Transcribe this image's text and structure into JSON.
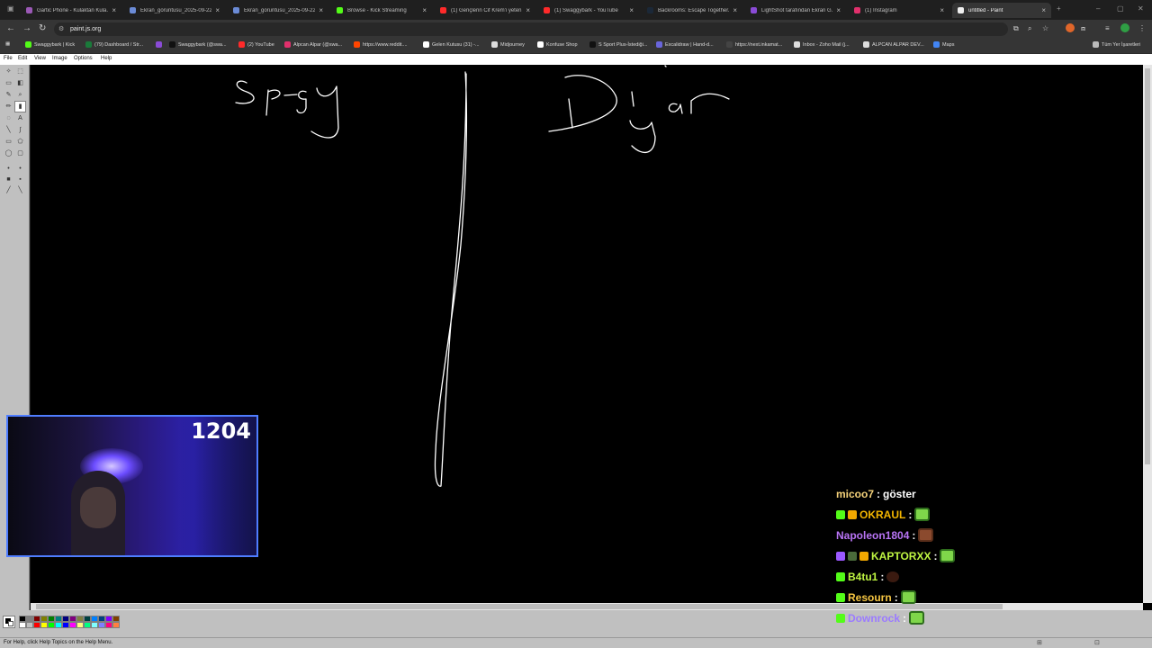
{
  "browser": {
    "tabs": [
      {
        "title": "Gartic Phone - Kulaktan Kula...",
        "color": "#9b59b6",
        "active": false
      },
      {
        "title": "Ekran_goruntusu_2025-09-22...",
        "color": "#6b8bd6",
        "active": false
      },
      {
        "title": "Ekran_goruntusu_2025-09-22...",
        "color": "#6b8bd6",
        "active": false
      },
      {
        "title": "Browse - Kick Streaming",
        "color": "#53fc18",
        "active": false
      },
      {
        "title": "(1) Gençlerin Cif Krem'i yeten...",
        "color": "#ff2a2a",
        "active": false
      },
      {
        "title": "(1) Swaggybark - YouTube",
        "color": "#ff2a2a",
        "active": false
      },
      {
        "title": "Backrooms: Escape Together...",
        "color": "#1b2838",
        "active": false
      },
      {
        "title": "LightShot tarafından Ekran G...",
        "color": "#8a4bd6",
        "active": false
      },
      {
        "title": "(1) Instagram",
        "color": "#e1306c",
        "active": false
      },
      {
        "title": "untitled - Paint",
        "color": "#f0f0f0",
        "active": true
      }
    ],
    "new_tab": "+",
    "url": "paint.js.org",
    "bookmarks": [
      {
        "label": "Swaggybark | Kick",
        "color": "#53fc18"
      },
      {
        "label": "(79) Dashboard / Str...",
        "color": "#1a7a3a"
      },
      {
        "label": "",
        "color": "#8a4bd6"
      },
      {
        "label": "Swaggybark (@swa...",
        "color": "#111111"
      },
      {
        "label": "(2) YouTube",
        "color": "#ff2a2a"
      },
      {
        "label": "Alpcan Alpar (@swa...",
        "color": "#e1306c"
      },
      {
        "label": "https://www.reddit....",
        "color": "#ff4500"
      },
      {
        "label": "Gelen Kutusu (31) -...",
        "color": "#ffffff"
      },
      {
        "label": "Midjourney",
        "color": "#dddddd"
      },
      {
        "label": "Konfuse Shop",
        "color": "#ffffff"
      },
      {
        "label": "S Sport Plus-İstediği...",
        "color": "#111111"
      },
      {
        "label": "Excalidraw | Hand-d...",
        "color": "#6965db"
      },
      {
        "label": "https://next.inkamat...",
        "color": "#444444"
      },
      {
        "label": "Inbox - Zoho Mail (j...",
        "color": "#dddddd"
      },
      {
        "label": "ALPCAN ALPAR DEV...",
        "color": "#dddddd"
      },
      {
        "label": "Maps",
        "color": "#4285f4"
      }
    ],
    "all_bookmarks": "Tüm Yer İşaretleri"
  },
  "paint": {
    "menu": [
      "File",
      "Edit",
      "View",
      "Image",
      "Options",
      "Help"
    ],
    "status": "For Help, click Help Topics on the Help Menu.",
    "palette": [
      "#000000",
      "#808080",
      "#800000",
      "#808000",
      "#008000",
      "#008080",
      "#000080",
      "#800080",
      "#808040",
      "#004040",
      "#0080ff",
      "#004080",
      "#8000ff",
      "#804000",
      "#ffffff",
      "#c0c0c0",
      "#ff0000",
      "#ffff00",
      "#00ff00",
      "#00ffff",
      "#0000ff",
      "#ff00ff",
      "#ffff80",
      "#00ff80",
      "#80ffff",
      "#8080ff",
      "#ff0080",
      "#ff8040"
    ]
  },
  "overlay": {
    "counter": "1204",
    "chat": [
      {
        "user": "micoo7",
        "user_color": "#f5d27a",
        "message": "göster",
        "badges": [],
        "emote": ""
      },
      {
        "user": "OKRAUL",
        "user_color": "#f2b500",
        "message": "",
        "badges": [
          "#53fc18",
          "#f2a800"
        ],
        "emote": "frog"
      },
      {
        "user": "Napoleon1804",
        "user_color": "#b874f5",
        "message": "",
        "badges": [],
        "emote": "brown"
      },
      {
        "user": "KAPTORXX",
        "user_color": "#bff542",
        "message": "",
        "badges": [
          "#9b59ff",
          "#4a6a3a",
          "#f2a800"
        ],
        "emote": "frog"
      },
      {
        "user": "B4tu1",
        "user_color": "#bff542",
        "message": "",
        "badges": [
          "#53fc18"
        ],
        "emote": "spider"
      },
      {
        "user": "Resourn",
        "user_color": "#f5c542",
        "message": "",
        "badges": [
          "#53fc18"
        ],
        "emote": "frog"
      },
      {
        "user": "Downrock",
        "user_color": "#9b7bff",
        "message": "",
        "badges": [
          "#53fc18"
        ],
        "emote": "frog"
      }
    ]
  }
}
